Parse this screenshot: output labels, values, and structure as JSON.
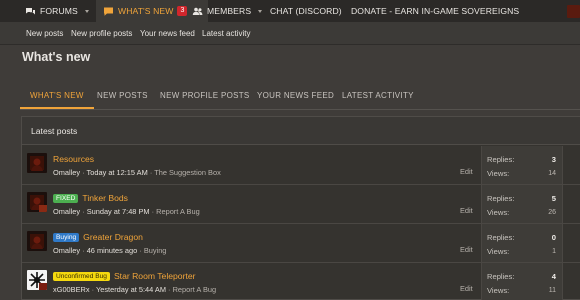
{
  "topnav": {
    "items": [
      {
        "label": "FORUMS",
        "icon": "chat-bubbles-icon"
      },
      {
        "label": "WHAT'S NEW",
        "icon": "speech-bubble-icon",
        "badge": "3"
      },
      {
        "label": "MEMBERS",
        "icon": "people-icon"
      },
      {
        "label": "CHAT (DISCORD)"
      },
      {
        "label": "DONATE - EARN IN-GAME SOVEREIGNS"
      }
    ]
  },
  "subnav": {
    "items": [
      "New posts",
      "New profile posts",
      "Your news feed",
      "Latest activity"
    ]
  },
  "page": {
    "title": "What's new",
    "tabs": [
      "WHAT'S NEW",
      "NEW POSTS",
      "NEW PROFILE POSTS",
      "YOUR NEWS FEED",
      "LATEST ACTIVITY"
    ]
  },
  "latest": {
    "heading": "Latest posts",
    "replies_label": "Replies:",
    "views_label": "Views:",
    "edit_label": "Edit",
    "rows": [
      {
        "prefix": "",
        "title": "Resources",
        "user": "Omalley",
        "time": "Today at 12:15 AM",
        "forum": "The Suggestion Box",
        "replies": "3",
        "views": "14"
      },
      {
        "prefix": "FIXED",
        "title": "Tinker Bods",
        "user": "Omalley",
        "time": "Sunday at 7:48 PM",
        "forum": "Report A Bug",
        "replies": "5",
        "views": "26"
      },
      {
        "prefix": "Buying",
        "title": "Greater Dragon",
        "user": "Omalley",
        "time": "46 minutes ago",
        "forum": "Buying",
        "replies": "0",
        "views": "1"
      },
      {
        "prefix": "Unconfirmed Bug",
        "title": "Star Room Teleporter",
        "user": "xG00BERx",
        "time": "Yesterday at 5:44 AM",
        "forum": "Report A Bug",
        "replies": "4",
        "views": "11"
      }
    ]
  },
  "colors": {
    "accent": "#f0a43a",
    "badge": "#d1262c",
    "prefix_fixed": "#4caf50",
    "prefix_buying": "#2f79c8",
    "prefix_unconfirmed": "#f5d90f"
  }
}
